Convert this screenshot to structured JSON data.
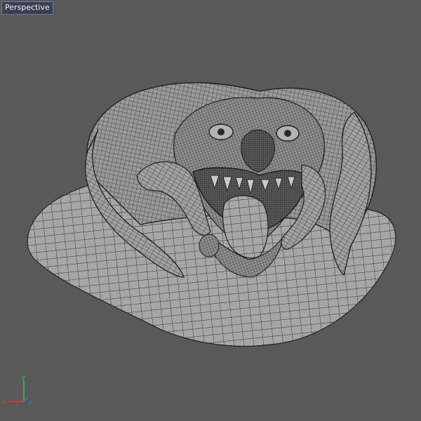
{
  "viewport": {
    "label": "Perspective",
    "background": "#595959",
    "label_background": "#3b3f52",
    "mesh_fill": "#a6a6a6",
    "wire_color": "#2a2a2a",
    "shading": "wireframe-on-shaded"
  },
  "model": {
    "icon": "demon-head-mesh-icon"
  },
  "gizmo": {
    "axes": [
      {
        "label": "y",
        "color": "#3cc83c"
      },
      {
        "label": "z",
        "color": "#4a63ff"
      },
      {
        "label": "x",
        "color": "#e03c3c"
      }
    ]
  }
}
